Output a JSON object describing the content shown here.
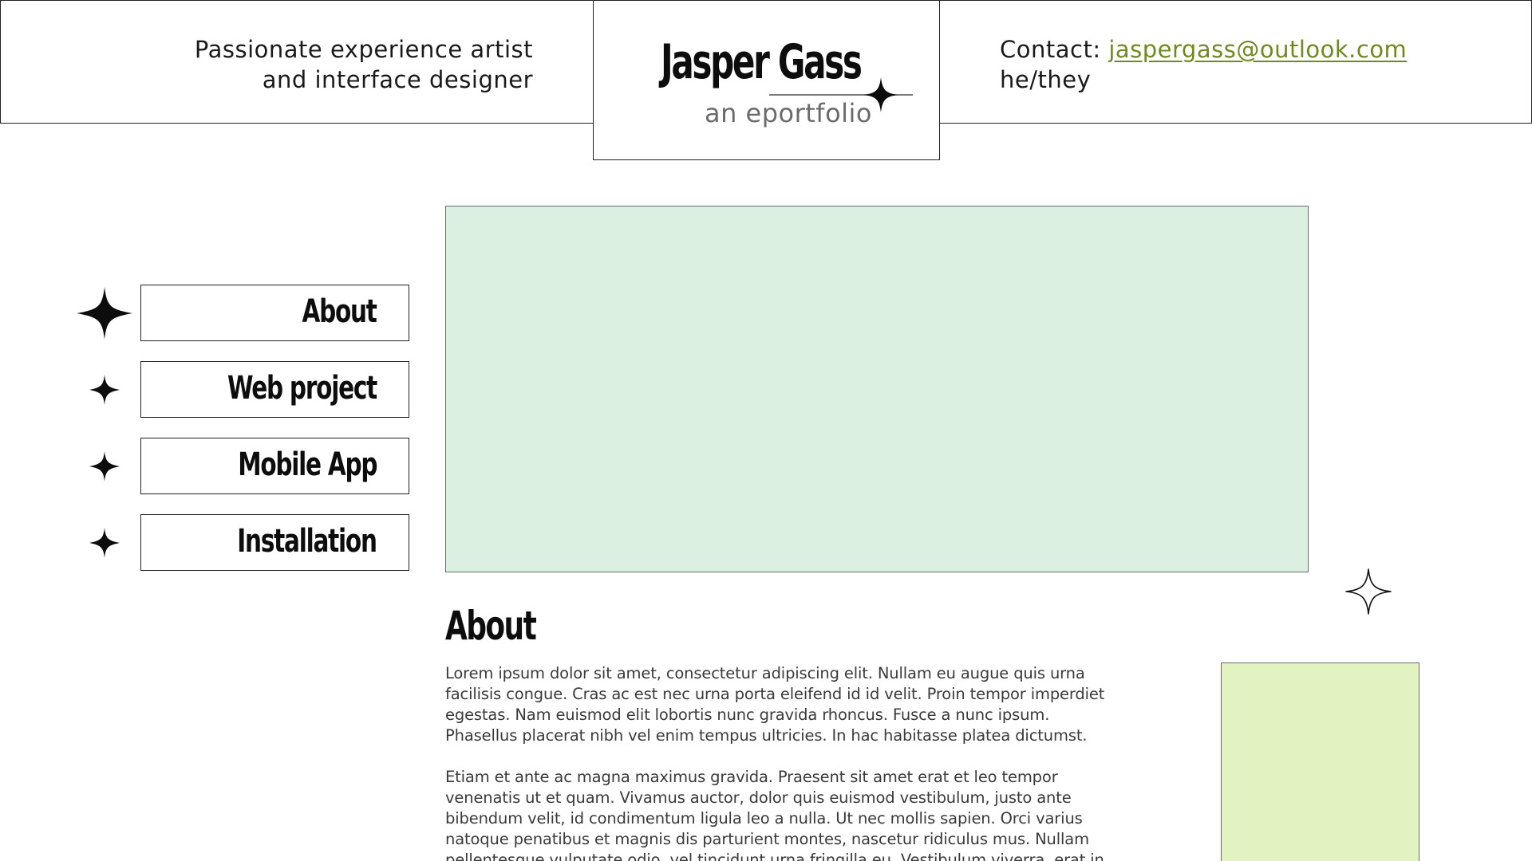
{
  "header": {
    "tagline_line1": "Passionate experience artist",
    "tagline_line2": "and interface designer",
    "brand_name": "Jasper Gass",
    "brand_subtitle": "an eportfolio",
    "contact_label": "Contact:",
    "contact_email": "jaspergass@outlook.com",
    "pronouns": "he/they"
  },
  "nav": {
    "items": [
      {
        "label": "About"
      },
      {
        "label": "Web project"
      },
      {
        "label": "Mobile App"
      },
      {
        "label": "Installation"
      }
    ]
  },
  "main": {
    "section_title": "About",
    "paragraphs": [
      "Lorem ipsum dolor sit amet, consectetur adipiscing elit. Nullam eu augue quis urna facilisis congue. Cras ac est nec urna porta eleifend id id velit. Proin tempor imperdiet egestas. Nam euismod elit lobortis nunc gravida rhoncus. Fusce a nunc ipsum. Phasellus placerat nibh vel enim tempus ultricies. In hac habitasse platea dictumst.",
      "Etiam et ante ac magna maximus gravida. Praesent sit amet erat et leo tempor venenatis ut et quam. Vivamus auctor, dolor quis euismod vestibulum, justo ante bibendum velit, id condimentum ligula leo a nulla. Ut nec mollis sapien. Orci varius natoque penatibus et magnis dis parturient montes, nascetur ridiculus mus. Nullam pellentesque vulputate odio, vel tincidunt urna fringilla eu. Vestibulum viverra, erat in"
    ]
  },
  "colors": {
    "link": "#6f8a1f",
    "hero_fill": "#dcf0e2",
    "side_fill": "#e2f2c0",
    "border": "#222222"
  },
  "icons": {
    "brand": "sparkle-icon",
    "nav_primary": "sparkle-icon",
    "nav_secondary": "sparkle-icon",
    "decoration": "sparkle-outline-icon"
  }
}
